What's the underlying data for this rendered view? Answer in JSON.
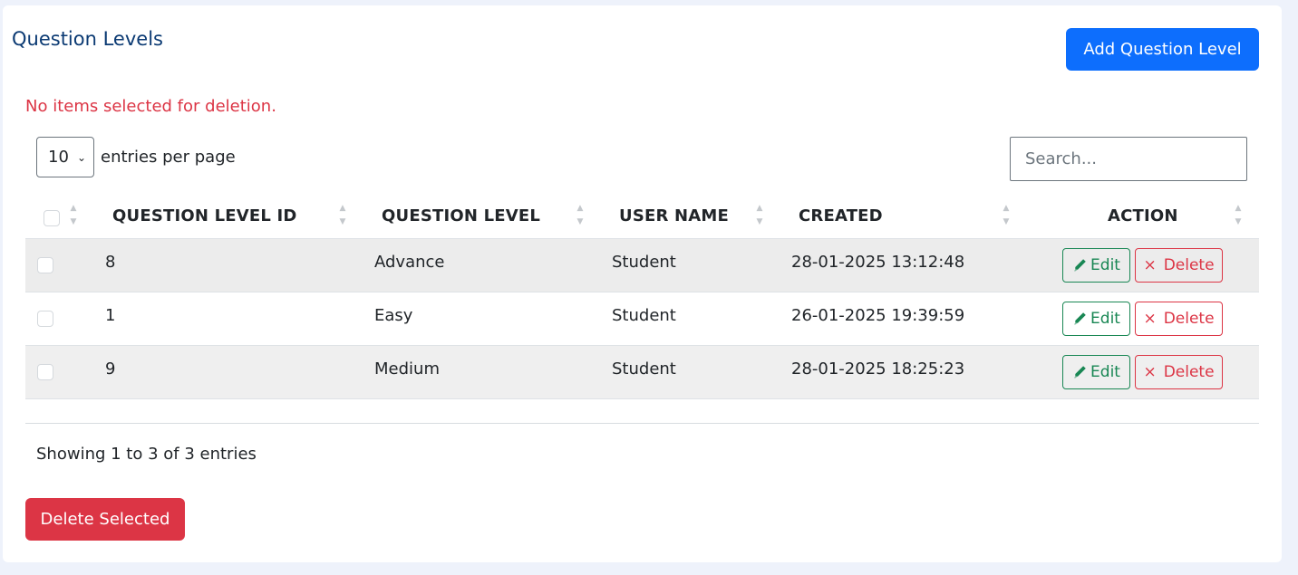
{
  "header": {
    "title": "Question Levels",
    "add_button_label": "Add Question Level"
  },
  "alert": {
    "message": "No items selected for deletion."
  },
  "controls": {
    "entries_value": "10",
    "entries_label": "entries per page",
    "search_placeholder": "Search..."
  },
  "table": {
    "columns": [
      "QUESTION LEVEL ID",
      "QUESTION LEVEL",
      "USER NAME",
      "CREATED",
      "ACTION"
    ],
    "rows": [
      {
        "id": "8",
        "level": "Advance",
        "user": "Student",
        "created": "28-01-2025 13:12:48"
      },
      {
        "id": "1",
        "level": "Easy",
        "user": "Student",
        "created": "26-01-2025 19:39:59"
      },
      {
        "id": "9",
        "level": "Medium",
        "user": "Student",
        "created": "28-01-2025 18:25:23"
      }
    ],
    "edit_label": "Edit",
    "delete_label": "Delete",
    "delete_icon": "×"
  },
  "footer": {
    "info": "Showing 1 to 3 of 3 entries",
    "delete_selected_label": "Delete Selected"
  },
  "colors": {
    "primary": "#0d6efd",
    "danger": "#dc3545",
    "success": "#198754",
    "title": "#0b3a73"
  },
  "icons": {
    "edit": "pencil-icon",
    "delete": "close-icon",
    "sort": "sort-icon"
  }
}
